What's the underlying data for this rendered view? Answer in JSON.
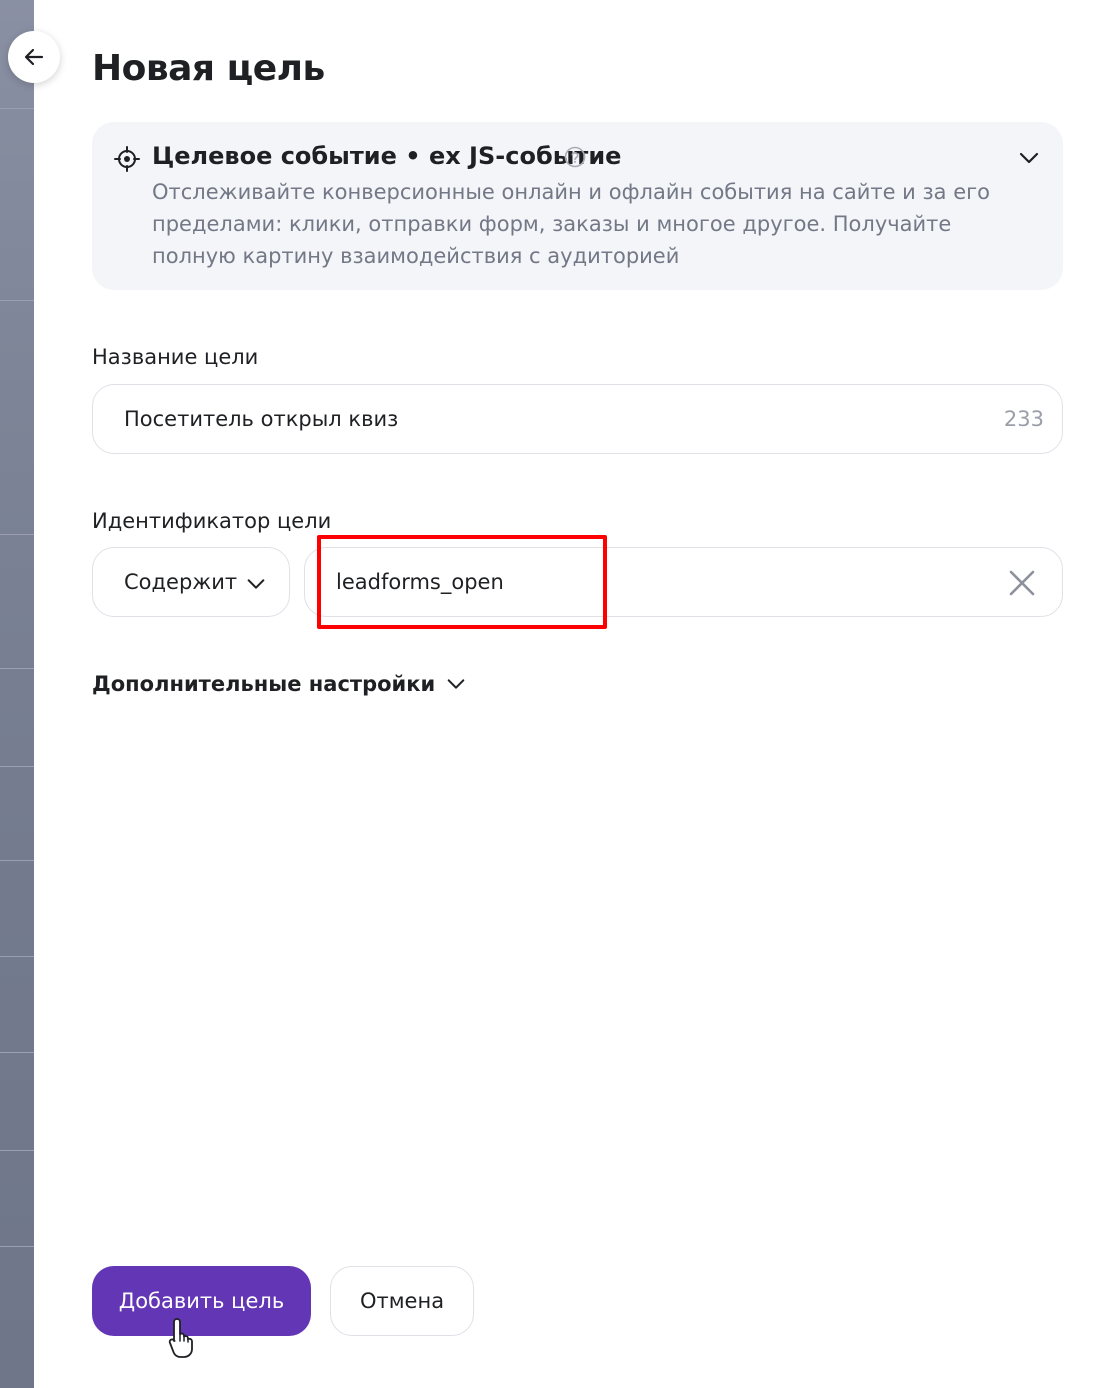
{
  "page": {
    "title": "Новая цель",
    "back_icon": "arrow-left-icon"
  },
  "info_card": {
    "icon": "target-icon",
    "title": "Целевое событие • ex JS-событие",
    "help_icon": "question-circle-icon",
    "expand_icon": "chevron-down-icon",
    "description": "Отслеживайте конверсионные онлайн и офлайн события на сайте и за его пределами: клики, отправки форм, заказы и многое другое. Получайте полную картину взаимодействия с аудиторией"
  },
  "goal_name": {
    "label": "Название цели",
    "value": "Посетитель открыл квиз",
    "counter": "233"
  },
  "goal_identifier": {
    "label": "Идентификатор цели",
    "match_type": "Содержит",
    "value": "leadforms_open",
    "clear_icon": "close-icon"
  },
  "advanced_settings": {
    "label": "Дополнительные настройки"
  },
  "actions": {
    "submit_label": "Добавить цель",
    "cancel_label": "Отмена"
  },
  "colors": {
    "primary": "#6236b4",
    "highlight": "#ff0000",
    "card_background": "#f4f5f8"
  }
}
